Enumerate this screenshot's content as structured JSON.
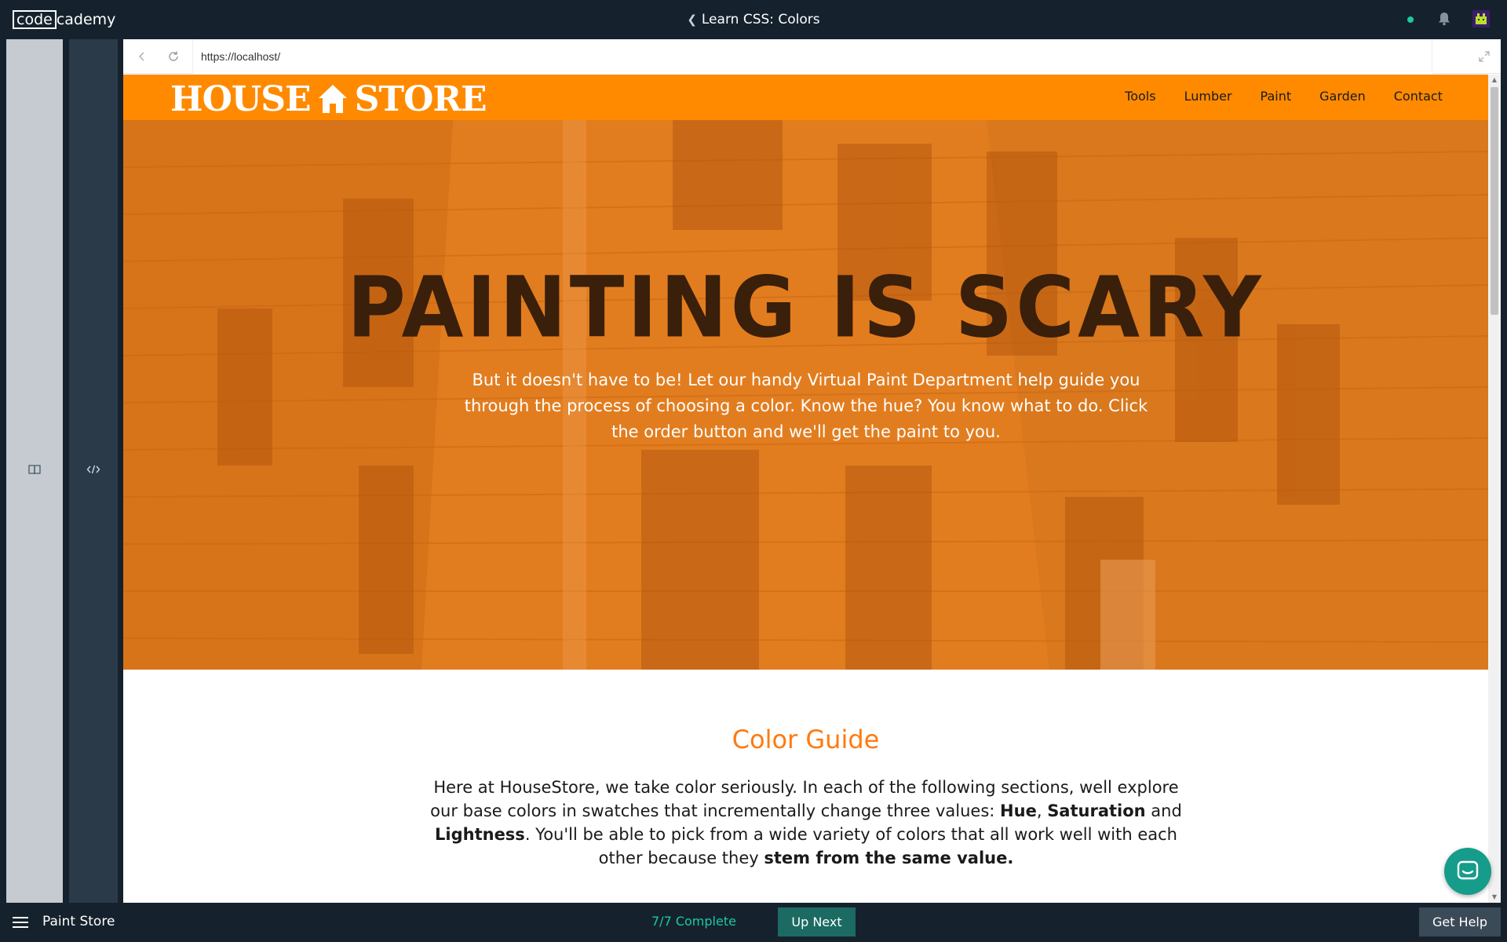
{
  "topbar": {
    "logo_code": "code",
    "logo_rest": "cademy",
    "course_title": "Learn CSS: Colors",
    "back_icon": "chevron-left-icon",
    "status_color": "#1ec8a5"
  },
  "browser": {
    "url": "https://localhost/",
    "back_icon": "arrow-left-icon",
    "refresh_icon": "refresh-icon",
    "expand_icon": "expand-icon"
  },
  "site": {
    "brand_left": "HOUSE",
    "brand_right": "STORE",
    "nav": [
      "Tools",
      "Lumber",
      "Paint",
      "Garden",
      "Contact"
    ],
    "accent_color": "#ff8a00",
    "hero_title": "PAINTING IS SCARY",
    "hero_text": "But it doesn't have to be! Let our handy Virtual Paint Department help guide you through the process of choosing a color. Know the hue? You know what to do. Click the order button and we'll get the paint to you.",
    "guide_title": "Color Guide",
    "guide_text": {
      "p1": "Here at HouseStore, we take color seriously. In each of the following sections, well explore our base colors in swatches that incrementally change three values: ",
      "hue": "Hue",
      "comma": ", ",
      "saturation": "Saturation",
      "and": " and ",
      "lightness": "Lightness",
      "p2": ". You'll be able to pick from a wide variety of colors that all work well with each other because they ",
      "stem": "stem from the same value."
    }
  },
  "bottombar": {
    "project_name": "Paint Store",
    "progress": "7/7 Complete",
    "up_next": "Up Next",
    "get_help": "Get Help"
  }
}
